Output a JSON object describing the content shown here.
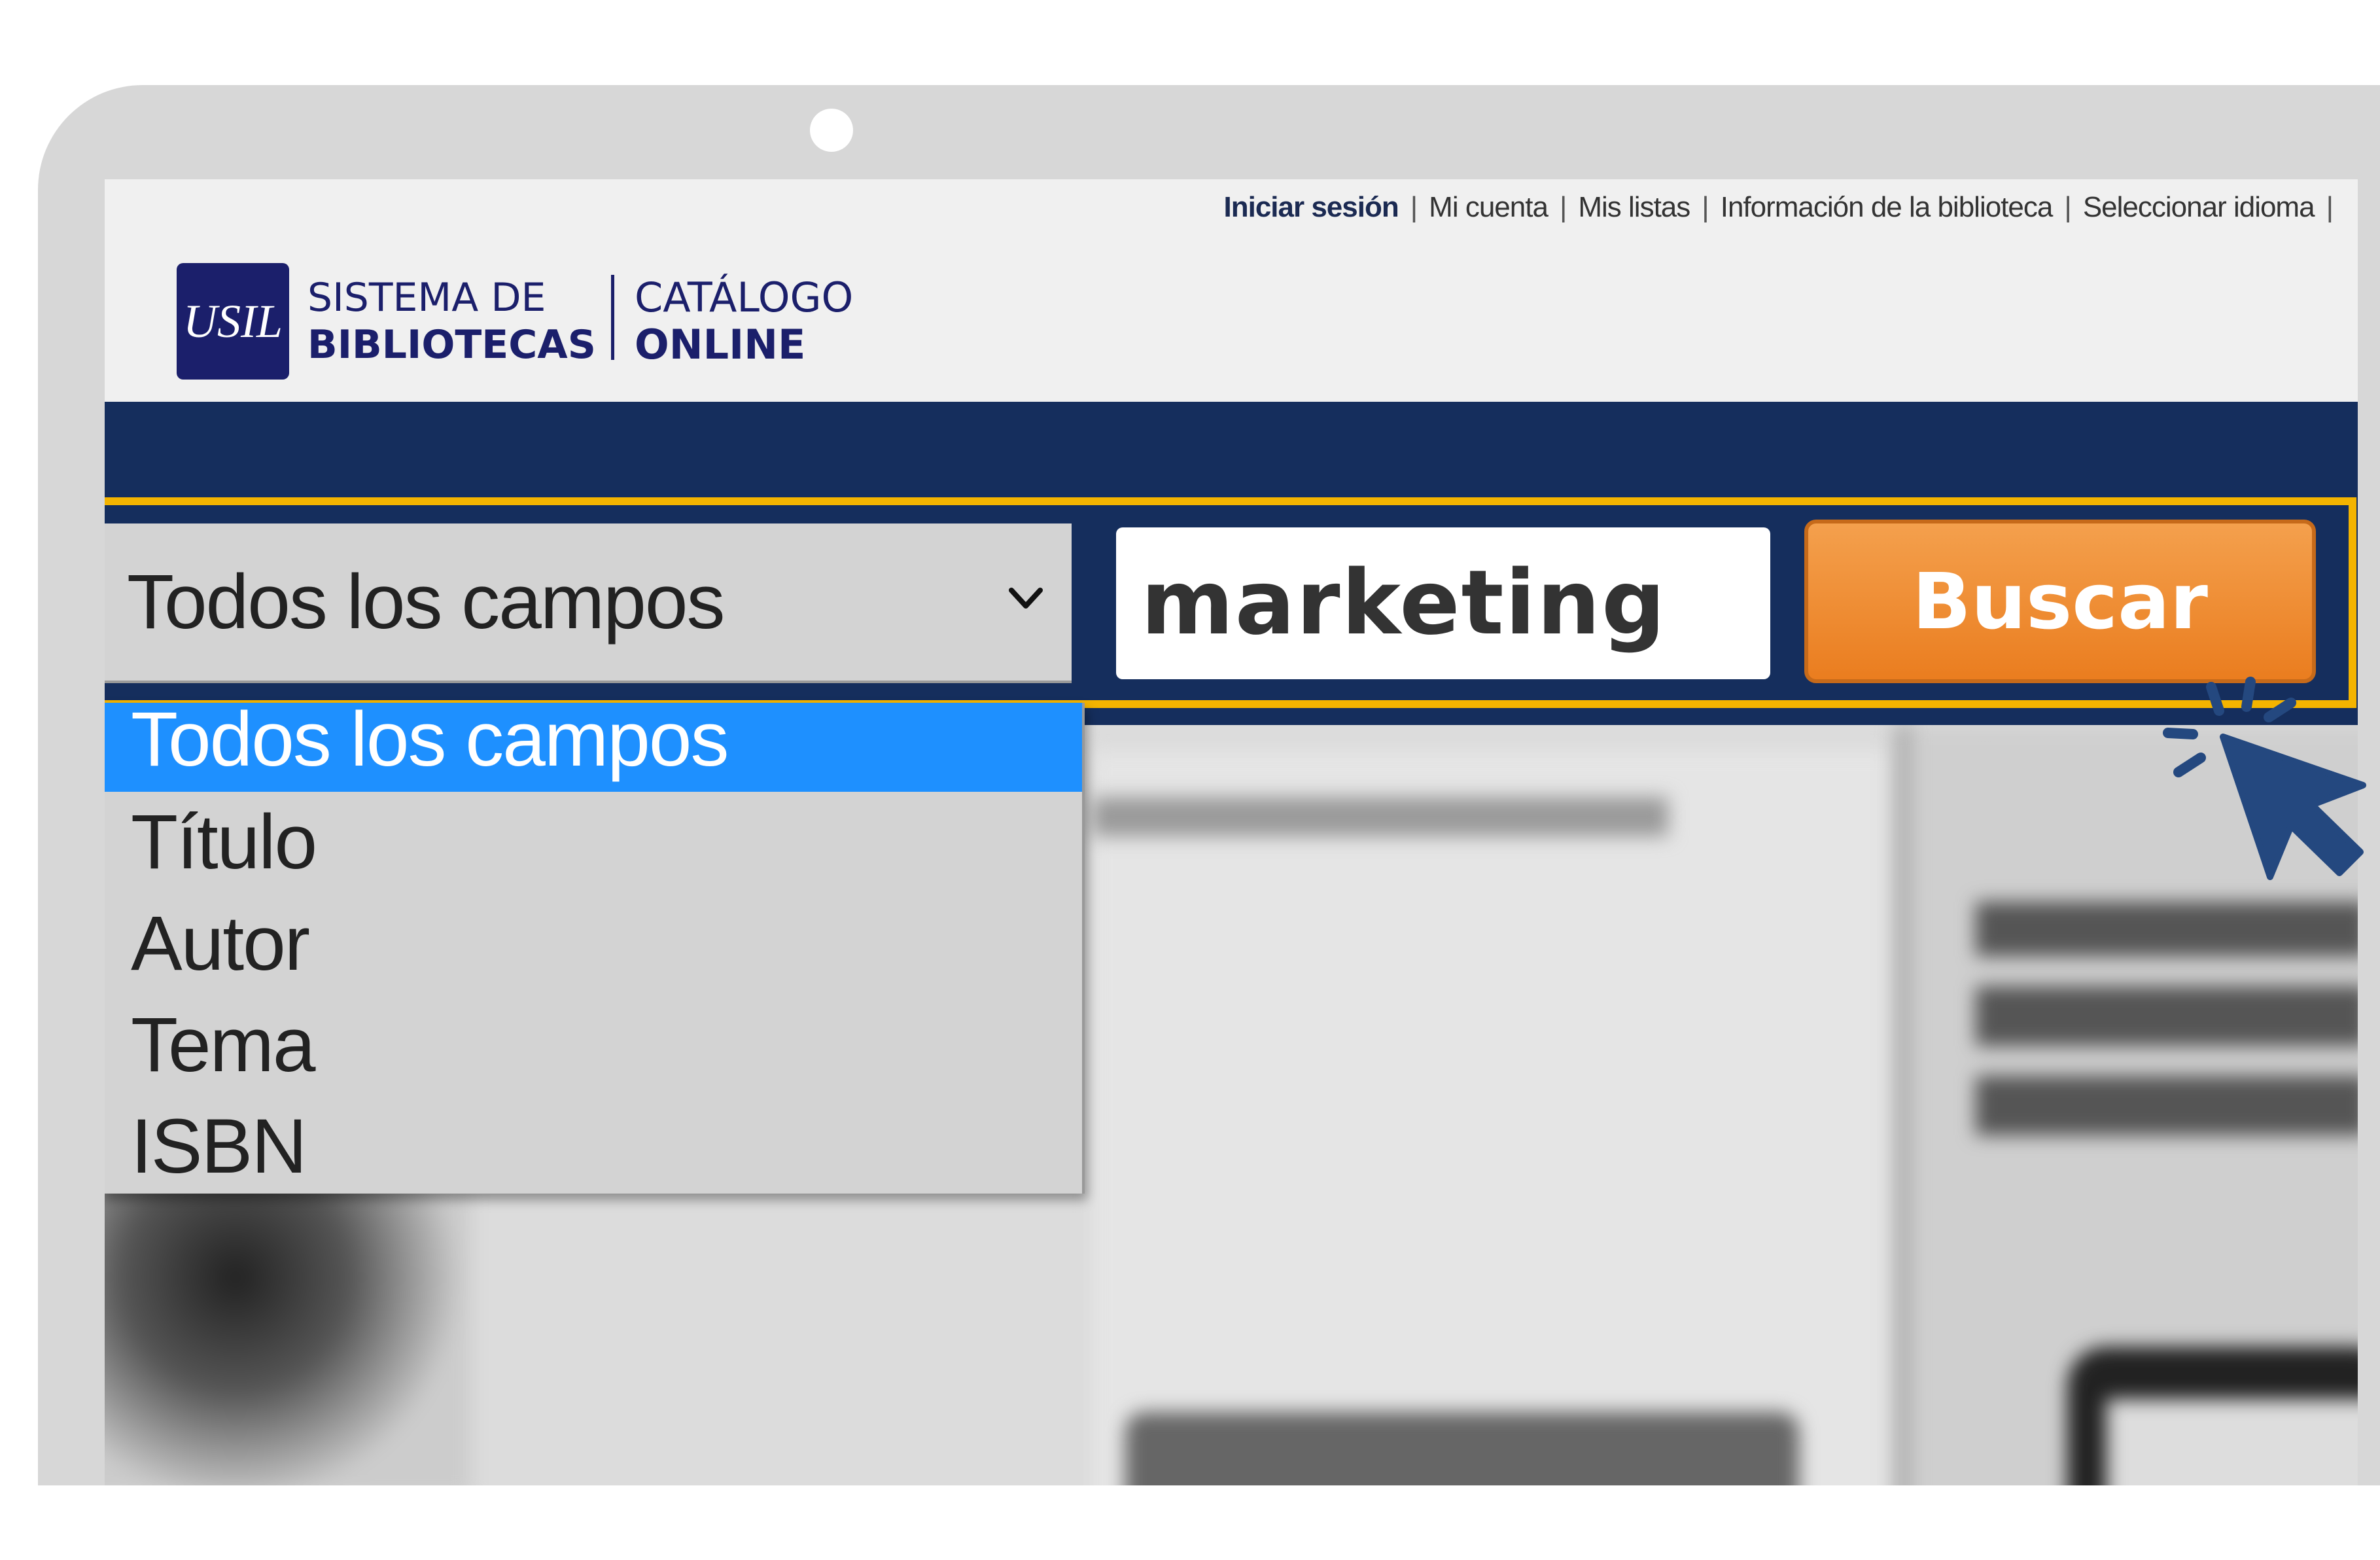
{
  "header": {
    "links": [
      "Iniciar sesión",
      "Mi cuenta",
      "Mis listas",
      "Información de la biblioteca",
      "Seleccionar idioma"
    ],
    "separator": "|"
  },
  "logo": {
    "mark": "USIL",
    "line1": "SISTEMA DE",
    "line2": "BIBLIOTECAS",
    "line3": "CATÁLOGO",
    "line4": "ONLINE"
  },
  "search": {
    "field_selected": "Todos los campos",
    "field_options": [
      "Todos los campos",
      "Título",
      "Autor",
      "Tema",
      "ISBN"
    ],
    "query_value": "marketing",
    "button_label": "Buscar"
  },
  "colors": {
    "navy": "#152e5d",
    "highlight": "#f4b400",
    "button_orange": "#ea7d1f",
    "selected_option": "#1e90ff",
    "cursor": "#24487f"
  },
  "icons": {
    "dropdown": "chevron-down-icon",
    "pointer": "hand-cursor-icon"
  }
}
